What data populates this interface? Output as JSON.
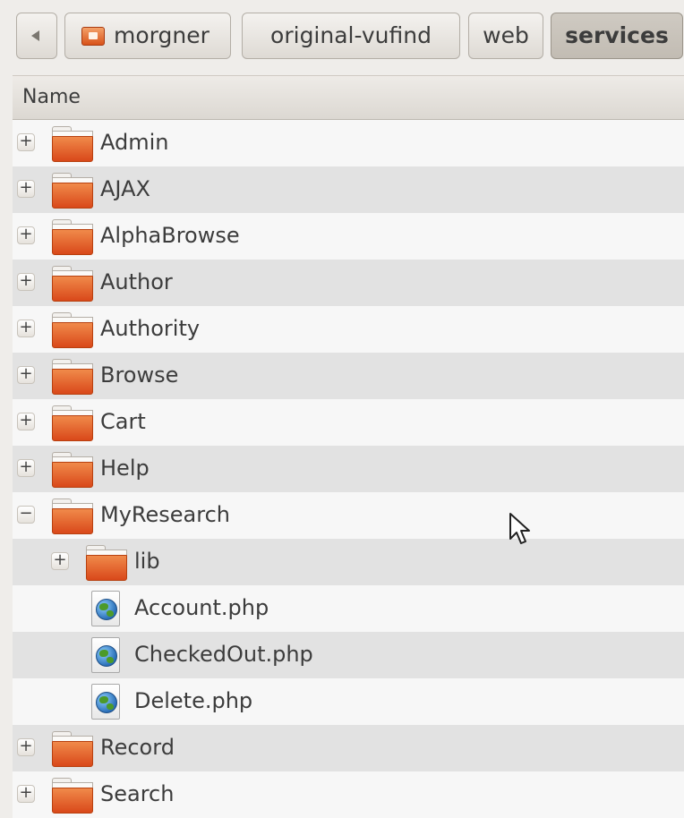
{
  "breadcrumb": {
    "items": [
      "morgner",
      "original-vufind",
      "web",
      "services"
    ]
  },
  "columns": {
    "name": "Name"
  },
  "rows": [
    {
      "label": "Admin",
      "type": "folder",
      "depth": 0,
      "expander": "+"
    },
    {
      "label": "AJAX",
      "type": "folder",
      "depth": 0,
      "expander": "+"
    },
    {
      "label": "AlphaBrowse",
      "type": "folder",
      "depth": 0,
      "expander": "+"
    },
    {
      "label": "Author",
      "type": "folder",
      "depth": 0,
      "expander": "+"
    },
    {
      "label": "Authority",
      "type": "folder",
      "depth": 0,
      "expander": "+"
    },
    {
      "label": "Browse",
      "type": "folder",
      "depth": 0,
      "expander": "+"
    },
    {
      "label": "Cart",
      "type": "folder",
      "depth": 0,
      "expander": "+"
    },
    {
      "label": "Help",
      "type": "folder",
      "depth": 0,
      "expander": "+"
    },
    {
      "label": "MyResearch",
      "type": "folder",
      "depth": 0,
      "expander": "−"
    },
    {
      "label": "lib",
      "type": "folder",
      "depth": 1,
      "expander": "+"
    },
    {
      "label": "Account.php",
      "type": "php-file",
      "depth": 1,
      "expander": ""
    },
    {
      "label": "CheckedOut.php",
      "type": "php-file",
      "depth": 1,
      "expander": ""
    },
    {
      "label": "Delete.php",
      "type": "php-file",
      "depth": 1,
      "expander": ""
    },
    {
      "label": "Record",
      "type": "folder",
      "depth": 0,
      "expander": "+"
    },
    {
      "label": "Search",
      "type": "folder",
      "depth": 0,
      "expander": "+"
    }
  ]
}
